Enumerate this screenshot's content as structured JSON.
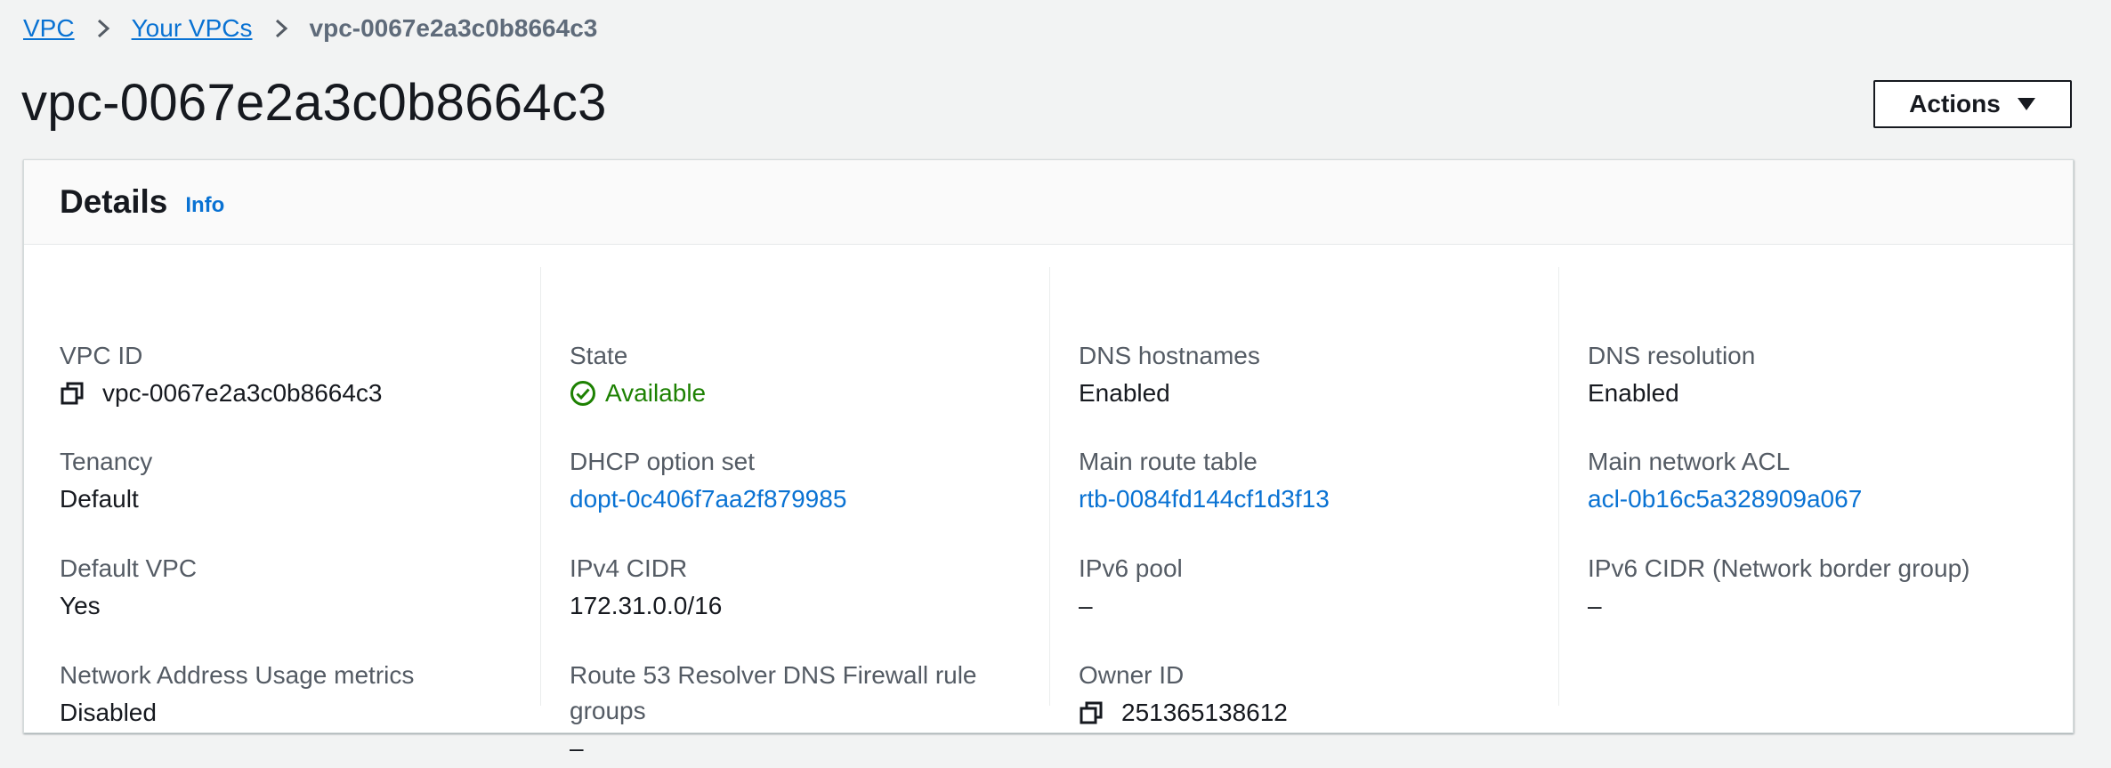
{
  "breadcrumb": {
    "items": [
      "VPC",
      "Your VPCs"
    ],
    "current": "vpc-0067e2a3c0b8664c3"
  },
  "page": {
    "title": "vpc-0067e2a3c0b8664c3",
    "actions_label": "Actions"
  },
  "details": {
    "title": "Details",
    "info_label": "Info",
    "vpc_id": {
      "label": "VPC ID",
      "value": "vpc-0067e2a3c0b8664c3"
    },
    "tenancy": {
      "label": "Tenancy",
      "value": "Default"
    },
    "default_vpc": {
      "label": "Default VPC",
      "value": "Yes"
    },
    "nau_metrics": {
      "label": "Network Address Usage metrics",
      "value": "Disabled"
    },
    "state": {
      "label": "State",
      "value": "Available"
    },
    "dhcp": {
      "label": "DHCP option set",
      "value": "dopt-0c406f7aa2f879985"
    },
    "ipv4_cidr": {
      "label": "IPv4 CIDR",
      "value": "172.31.0.0/16"
    },
    "r53_firewall": {
      "label_line1": "Route 53 Resolver DNS Firewall rule",
      "label_line2": "groups",
      "value": "–"
    },
    "dns_hostnames": {
      "label": "DNS hostnames",
      "value": "Enabled"
    },
    "main_route_table": {
      "label": "Main route table",
      "value": "rtb-0084fd144cf1d3f13"
    },
    "ipv6_pool": {
      "label": "IPv6 pool",
      "value": "–"
    },
    "owner_id": {
      "label": "Owner ID",
      "value": "251365138612"
    },
    "dns_resolution": {
      "label": "DNS resolution",
      "value": "Enabled"
    },
    "main_acl": {
      "label": "Main network ACL",
      "value": "acl-0b16c5a328909a067"
    },
    "ipv6_cidr": {
      "label": "IPv6 CIDR (Network border group)",
      "value": "–"
    }
  },
  "colors": {
    "link": "#0972d3",
    "success": "#1d8102",
    "page_bg": "#f2f3f3"
  },
  "icons": [
    "chevron-right-icon",
    "caret-down-icon",
    "copy-icon",
    "status-check-icon"
  ]
}
